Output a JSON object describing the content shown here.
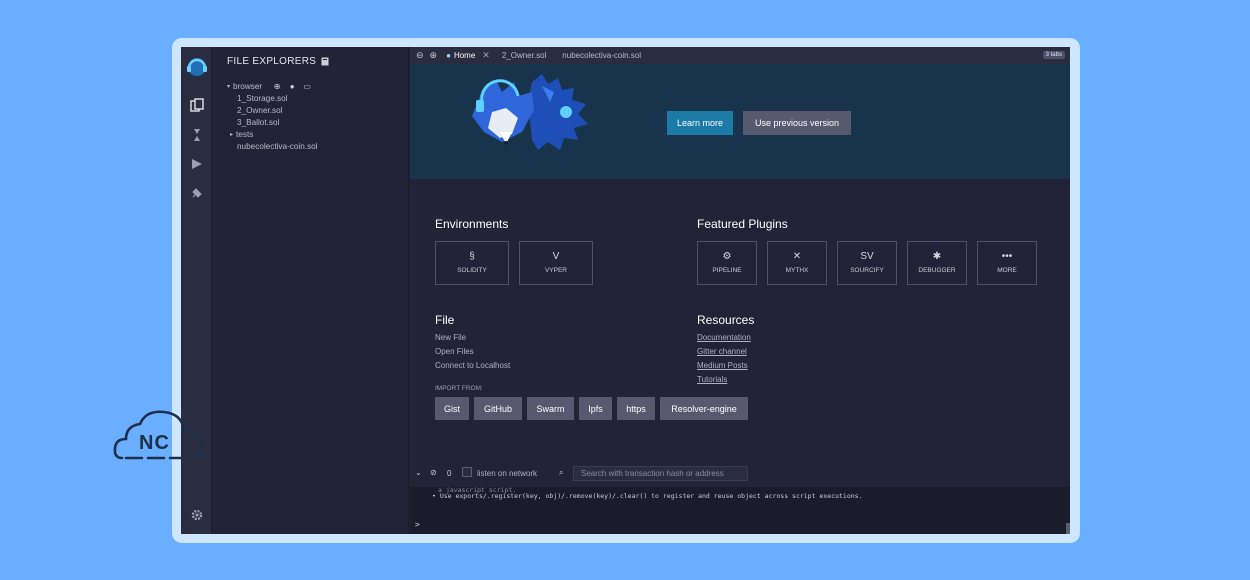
{
  "colors": {
    "background": "#6aafff",
    "frame": "#cfe6ff",
    "accent": "#1b7aa6",
    "hero": "#17344c"
  },
  "sidebar_icons": [
    "remix-logo-icon",
    "files-icon",
    "solidity-compiler-icon",
    "deploy-icon",
    "plugin-icon",
    "settings-icon"
  ],
  "explorer": {
    "title": "FILE EXPLORERS",
    "workspace": "browser",
    "files": [
      "1_Storage.sol",
      "2_Owner.sol",
      "3_Ballot.sol"
    ],
    "folder": "tests",
    "extra_file": "nubecolectiva-coin.sol"
  },
  "tabs": {
    "home": "Home",
    "items": [
      "2_Owner.sol",
      "nubecolectiva-coin.sol"
    ],
    "count": "3 tabs"
  },
  "hero": {
    "learn_more": "Learn more",
    "previous": "Use previous version"
  },
  "environments": {
    "title": "Environments",
    "items": [
      {
        "label": "SOLIDITY"
      },
      {
        "label": "VYPER"
      }
    ]
  },
  "plugins": {
    "title": "Featured Plugins",
    "items": [
      {
        "label": "PIPELINE"
      },
      {
        "label": "MYTHX"
      },
      {
        "label": "SOURCIFY"
      },
      {
        "label": "DEBUGGER"
      },
      {
        "label": "MORE"
      }
    ]
  },
  "file": {
    "title": "File",
    "links": [
      "New File",
      "Open Files",
      "Connect to Localhost"
    ],
    "import_label": "IMPORT FROM:",
    "import_buttons": [
      "Gist",
      "GitHub",
      "Swarm",
      "Ipfs",
      "https",
      "Resolver-engine"
    ]
  },
  "resources": {
    "title": "Resources",
    "links": [
      "Documentation",
      "Gitter channel",
      "Medium Posts",
      "Tutorials"
    ]
  },
  "terminal": {
    "count": "0",
    "listen": "listen on network",
    "search_placeholder": "Search with transaction hash or address",
    "line1": "a javascript script.",
    "line2": "• Use exports/.register(key, obj)/.remove(key)/.clear() to register and reuse object across script executions.",
    "prompt": ">"
  },
  "brand": {
    "logo_text": "NC"
  }
}
